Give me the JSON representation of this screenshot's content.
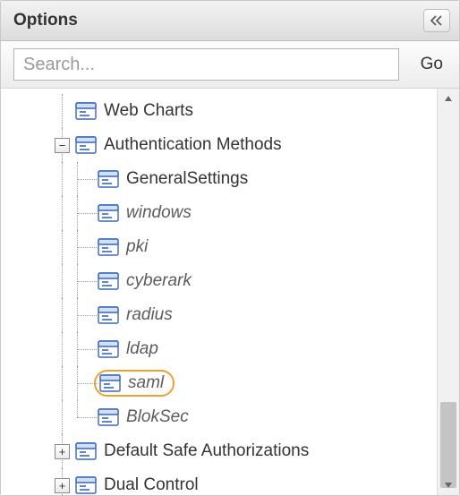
{
  "panel": {
    "title": "Options",
    "collapse_tooltip": "Collapse"
  },
  "search": {
    "placeholder": "Search...",
    "go_label": "Go"
  },
  "tree": {
    "nodes": [
      {
        "id": "web-charts",
        "label": "Web Charts",
        "italic": false,
        "depth": 1,
        "toggle": "none",
        "last_in_group": false
      },
      {
        "id": "auth-methods",
        "label": "Authentication Methods",
        "italic": false,
        "depth": 1,
        "toggle": "minus",
        "last_in_group": false,
        "children": [
          {
            "id": "general-settings",
            "label": "GeneralSettings",
            "italic": false
          },
          {
            "id": "windows",
            "label": "windows",
            "italic": true
          },
          {
            "id": "pki",
            "label": "pki",
            "italic": true
          },
          {
            "id": "cyberark",
            "label": "cyberark",
            "italic": true
          },
          {
            "id": "radius",
            "label": "radius",
            "italic": true
          },
          {
            "id": "ldap",
            "label": "ldap",
            "italic": true
          },
          {
            "id": "saml",
            "label": "saml",
            "italic": true,
            "highlight": true
          },
          {
            "id": "bloksec",
            "label": "BlokSec",
            "italic": true
          }
        ]
      },
      {
        "id": "default-safe-auth",
        "label": "Default Safe Authorizations",
        "italic": false,
        "depth": 1,
        "toggle": "plus",
        "last_in_group": false
      },
      {
        "id": "dual-control",
        "label": "Dual Control",
        "italic": false,
        "depth": 1,
        "toggle": "plus",
        "last_in_group": false
      }
    ]
  },
  "icons": {
    "tree_item": "properties-icon"
  }
}
